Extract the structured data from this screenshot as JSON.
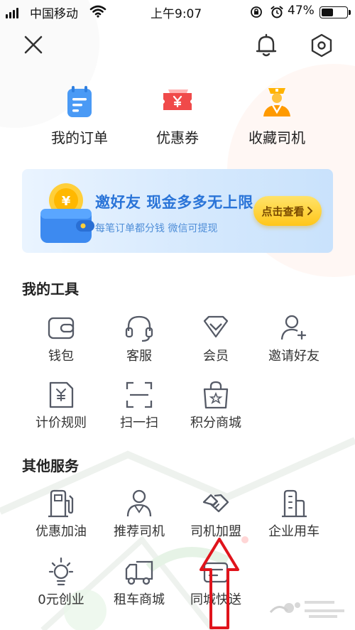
{
  "status_bar": {
    "carrier": "中国移动",
    "time": "上午9:07",
    "battery": "47%",
    "battery_level": 0.47
  },
  "quick_entries": [
    {
      "label": "我的订单",
      "icon": "order-icon"
    },
    {
      "label": "优惠券",
      "icon": "coupon-icon"
    },
    {
      "label": "收藏司机",
      "icon": "driver-favorite-icon"
    }
  ],
  "banner": {
    "title": "邀好友 现金多多无上限",
    "subtitle": "每笔订单都分钱 微信可提现",
    "button": "点击查看"
  },
  "my_tools": {
    "title": "我的工具",
    "items": [
      {
        "label": "钱包",
        "icon": "wallet-icon"
      },
      {
        "label": "客服",
        "icon": "headset-icon"
      },
      {
        "label": "会员",
        "icon": "diamond-icon"
      },
      {
        "label": "邀请好友",
        "icon": "add-user-icon"
      },
      {
        "label": "计价规则",
        "icon": "price-rule-icon"
      },
      {
        "label": "扫一扫",
        "icon": "scan-icon"
      },
      {
        "label": "积分商城",
        "icon": "shopping-bag-icon"
      }
    ]
  },
  "other_services": {
    "title": "其他服务",
    "items": [
      {
        "label": "优惠加油",
        "icon": "fuel-icon"
      },
      {
        "label": "推荐司机",
        "icon": "driver-icon"
      },
      {
        "label": "司机加盟",
        "icon": "handshake-icon"
      },
      {
        "label": "企业用车",
        "icon": "building-icon"
      },
      {
        "label": "0元创业",
        "icon": "lightbulb-icon"
      },
      {
        "label": "租车商城",
        "icon": "truck-icon"
      },
      {
        "label": "同城快送",
        "icon": "delivery-card-icon"
      }
    ]
  },
  "colors": {
    "accent_blue": "#2a74d8",
    "button_yellow": "#ffc61a",
    "annotation_red": "#e0141c",
    "icon_stroke": "#555a66"
  }
}
